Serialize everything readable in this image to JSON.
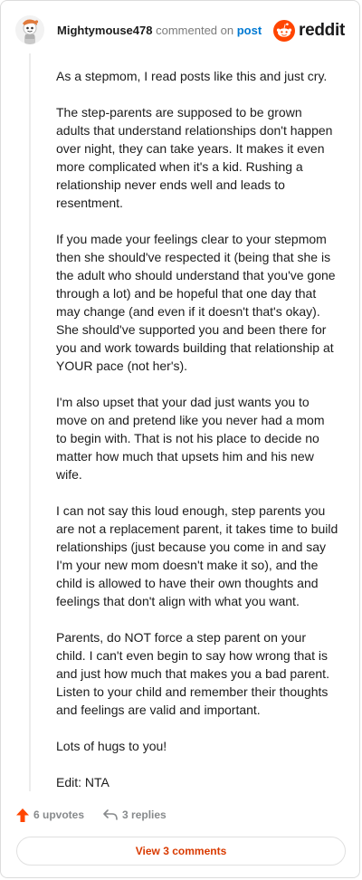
{
  "comment": {
    "username": "Mightymouse478",
    "action": "commented on",
    "target": "post",
    "paragraphs": [
      "As a stepmom, I read posts like this and just cry.",
      "The step-parents are supposed to be grown adults that understand relationships don't happen over night, they can take years. It makes it even more complicated when it's a kid. Rushing a relationship never ends well and leads to resentment.",
      "If you made your feelings clear to your stepmom then she should've respected it (being that she is the adult who should understand that you've gone through a lot) and be hopeful that one day that may change (and even if it doesn't that's okay). She should've supported you and been there for you and work towards building that relationship at YOUR pace (not her's).",
      "I'm also upset that your dad just wants you to move on and pretend like you never had a mom to begin with. That is not his place to decide no matter how much that upsets him and his new wife.",
      "I can not say this loud enough, step parents you are not a replacement parent, it takes time to build relationships (just because you come in and say I'm your new mom doesn't make it so), and the child is allowed to have their own thoughts and feelings that don't align with what you want.",
      "Parents, do NOT force a step parent on your child. I can't even begin to say how wrong that is and just how much that makes you a bad parent. Listen to your child and remember their thoughts and feelings are valid and important.",
      "Lots of hugs to you!",
      "Edit: NTA"
    ]
  },
  "brand": {
    "wordmark": "reddit",
    "icon": "reddit-snoo-icon",
    "color": "#ff4500"
  },
  "footer": {
    "upvotes": "6 upvotes",
    "replies": "3 replies",
    "upvote_icon": "upvote-arrow-icon",
    "reply_icon": "reply-arrow-icon",
    "view_button": "View 3 comments"
  },
  "colors": {
    "link": "#0079d3",
    "upvote": "#ff4500",
    "view_button_text": "#d93a00",
    "meta_gray": "#878a8c"
  }
}
